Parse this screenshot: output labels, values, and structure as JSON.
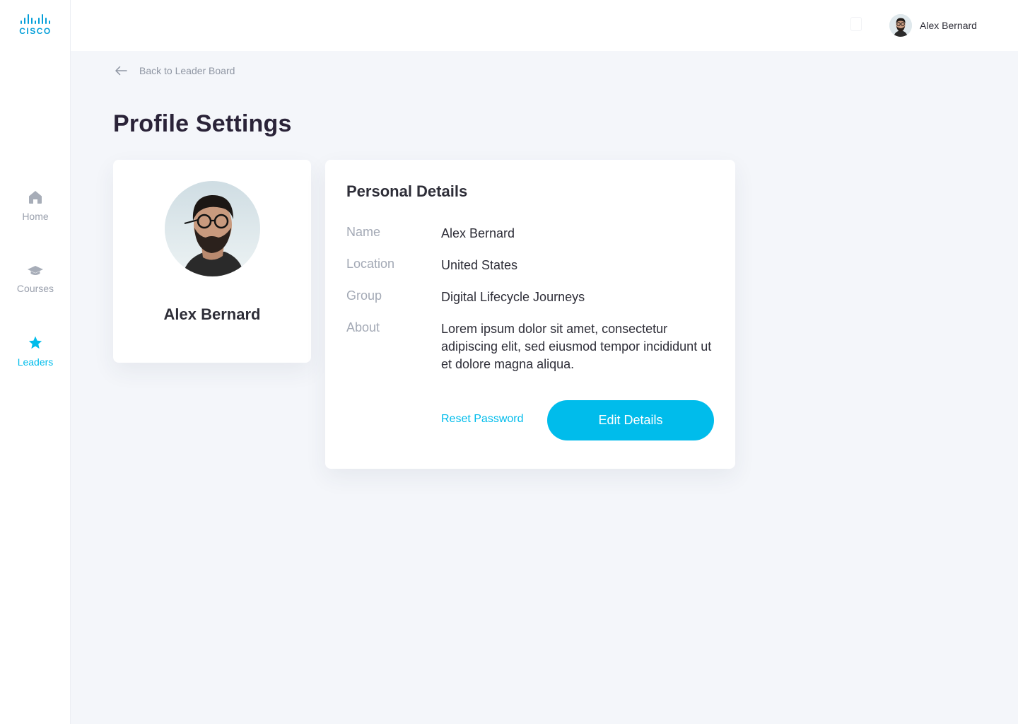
{
  "brand": {
    "logo_text": "CISCO",
    "accent": "#00bceb",
    "logo_color": "#049fd9"
  },
  "sidebar": {
    "items": [
      {
        "label": "Home",
        "icon": "home-icon",
        "active": false
      },
      {
        "label": "Courses",
        "icon": "graduation-cap-icon",
        "active": false
      },
      {
        "label": "Leaders",
        "icon": "star-icon",
        "active": true
      }
    ]
  },
  "header": {
    "user_name": "Alex Bernard",
    "avatar": "user-avatar"
  },
  "back_link": {
    "label": "Back to Leader Board",
    "icon": "arrow-left-icon"
  },
  "page": {
    "title": "Profile Settings"
  },
  "profile_card": {
    "name": "Alex Bernard",
    "avatar": "profile-photo"
  },
  "details": {
    "title": "Personal Details",
    "fields": [
      {
        "label": "Name",
        "value": "Alex Bernard"
      },
      {
        "label": "Location",
        "value": "United States"
      },
      {
        "label": "Group",
        "value": "Digital Lifecycle Journeys"
      },
      {
        "label": "About",
        "value": "Lorem ipsum dolor sit amet, consectetur adipiscing elit, sed eiusmod tempor incididunt ut et dolore magna aliqua."
      }
    ],
    "reset_label": "Reset Password",
    "edit_label": "Edit Details"
  }
}
